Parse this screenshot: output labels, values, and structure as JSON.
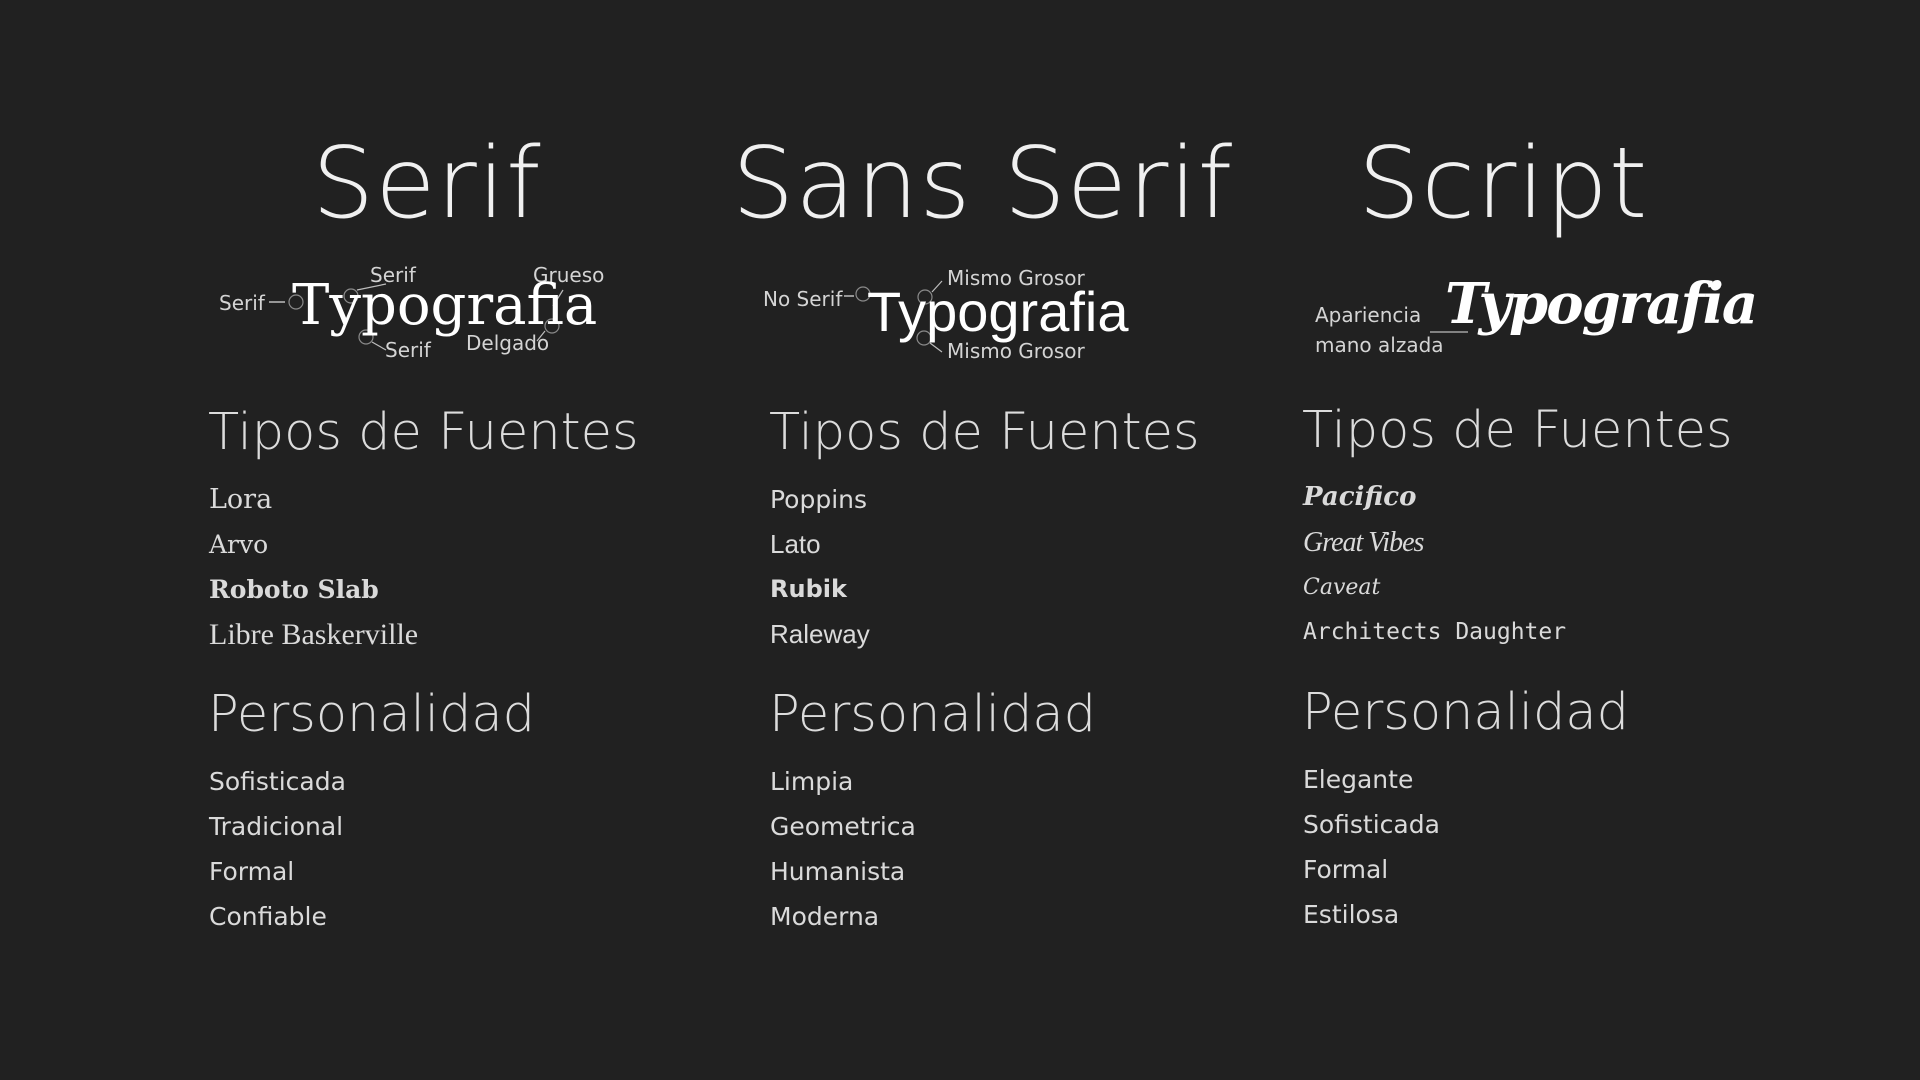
{
  "serif": {
    "title": "Serif",
    "specimen": "Typografia",
    "annotations": {
      "left": "Serif",
      "top_serif": "Serif",
      "top_right": "Grueso",
      "bottom_serif": "Serif",
      "bottom_right": "Delgado"
    },
    "fonts_heading": "Tipos de Fuentes",
    "fonts": [
      "Lora",
      "Arvo",
      "Roboto Slab",
      "Libre Baskerville"
    ],
    "personality_heading": "Personalidad",
    "personality": [
      "Sofisticada",
      "Tradicional",
      "Formal",
      "Confiable"
    ]
  },
  "sans_serif": {
    "title": "Sans Serif",
    "specimen": "Typografia",
    "annotations": {
      "left": "No Serif",
      "top": "Mismo Grosor",
      "bottom": "Mismo Grosor"
    },
    "fonts_heading": "Tipos de Fuentes",
    "fonts": [
      "Poppins",
      "Lato",
      "Rubik",
      "Raleway"
    ],
    "personality_heading": "Personalidad",
    "personality": [
      "Limpia",
      "Geometrica",
      "Humanista",
      "Moderna"
    ]
  },
  "script": {
    "title": "Script",
    "specimen": "Typografia",
    "annotations": {
      "left_line1": "Apariencia",
      "left_line2": "mano alzada"
    },
    "fonts_heading": "Tipos de Fuentes",
    "fonts": [
      "Pacifico",
      "Great Vibes",
      "Caveat",
      "Architects Daughter"
    ],
    "personality_heading": "Personalidad",
    "personality": [
      "Elegante",
      "Sofisticada",
      "Formal",
      "Estilosa"
    ]
  },
  "colors": {
    "background": "#212121",
    "text": "#e8e8e8",
    "annotation_line": "#bdbdbd"
  }
}
